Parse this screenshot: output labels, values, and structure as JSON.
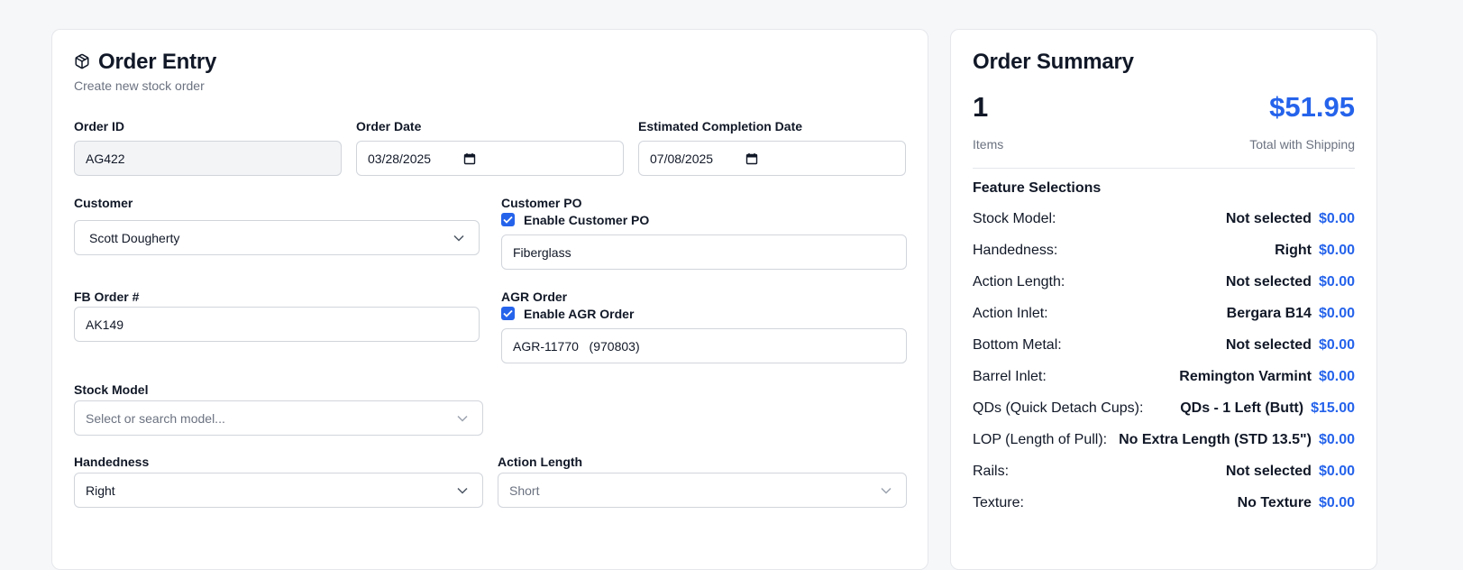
{
  "entry": {
    "title": "Order Entry",
    "subtitle": "Create new stock order",
    "fields": {
      "order_id": {
        "label": "Order ID",
        "value": "AG422"
      },
      "order_date": {
        "label": "Order Date",
        "value": "03/28/2025"
      },
      "est_completion": {
        "label": "Estimated Completion Date",
        "value": "07/08/2025"
      },
      "customer": {
        "label": "Customer",
        "value": "Scott Dougherty"
      },
      "customer_po": {
        "label": "Customer PO",
        "checkbox_label": "Enable Customer PO",
        "checked": true,
        "value": "Fiberglass"
      },
      "fb_order": {
        "label": "FB Order #",
        "value": "AK149"
      },
      "agr_order": {
        "label": "AGR Order",
        "checkbox_label": "Enable AGR Order",
        "checked": true,
        "value": "AGR-11770   (970803)"
      },
      "stock_model": {
        "label": "Stock Model",
        "placeholder": "Select or search model..."
      },
      "handedness": {
        "label": "Handedness",
        "value": "Right"
      },
      "action_length": {
        "label": "Action Length",
        "value": "Short"
      }
    }
  },
  "summary": {
    "title": "Order Summary",
    "items_count": "1",
    "items_label": "Items",
    "total": "$51.95",
    "total_label": "Total with Shipping",
    "section_title": "Feature Selections",
    "features": [
      {
        "name": "Stock Model:",
        "value": "Not selected",
        "price": "$0.00"
      },
      {
        "name": "Handedness:",
        "value": "Right",
        "price": "$0.00"
      },
      {
        "name": "Action Length:",
        "value": "Not selected",
        "price": "$0.00"
      },
      {
        "name": "Action Inlet:",
        "value": "Bergara B14",
        "price": "$0.00"
      },
      {
        "name": "Bottom Metal:",
        "value": "Not selected",
        "price": "$0.00"
      },
      {
        "name": "Barrel Inlet:",
        "value": "Remington Varmint",
        "price": "$0.00"
      },
      {
        "name": "QDs (Quick Detach Cups):",
        "value": "QDs - 1 Left (Butt)",
        "price": "$15.00"
      },
      {
        "name": "LOP (Length of Pull):",
        "value": "No Extra Length (STD 13.5\")",
        "price": "$0.00"
      },
      {
        "name": "Rails:",
        "value": "Not selected",
        "price": "$0.00"
      },
      {
        "name": "Texture:",
        "value": "No Texture",
        "price": "$0.00"
      }
    ]
  },
  "colors": {
    "accent": "#2563eb",
    "page_background": "#f6f7f9",
    "muted_text": "#6b7280",
    "border": "#d1d5db"
  },
  "icons": {
    "title_icon": "package-icon",
    "date_icon": "calendar-icon",
    "dropdown_icon": "chevron-down-icon",
    "checkbox_icon": "check-icon"
  }
}
